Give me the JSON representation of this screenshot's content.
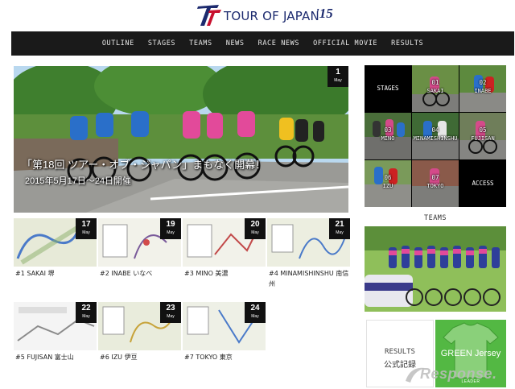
{
  "header": {
    "logo_text": "TOUR OF JAPAN",
    "logo_year": "'15"
  },
  "nav": {
    "items": [
      "OUTLINE",
      "STAGES",
      "TEAMS",
      "NEWS",
      "RACE NEWS",
      "OFFICIAL MOVIE",
      "RESULTS"
    ]
  },
  "hero": {
    "badge_day": "1",
    "badge_month": "May",
    "headline": "「第18回 ツアー・オブ・ジャパン」まもなく開幕！",
    "subline": "2015年5月17日〜24日開催"
  },
  "stages": [
    {
      "day": "17",
      "month": "May",
      "label": "#1 SAKAI 堺"
    },
    {
      "day": "19",
      "month": "May",
      "label": "#2 INABE いなべ"
    },
    {
      "day": "20",
      "month": "May",
      "label": "#3 MINO 美濃"
    },
    {
      "day": "21",
      "month": "May",
      "label": "#4 MINAMISHINSHU 南信州"
    },
    {
      "day": "22",
      "month": "May",
      "label": "#5 FUJISAN 富士山"
    },
    {
      "day": "23",
      "month": "May",
      "label": "#6 IZU 伊豆"
    },
    {
      "day": "24",
      "month": "May",
      "label": "#7 TOKYO 東京"
    }
  ],
  "stage_grid": {
    "title": "STAGES",
    "cells": [
      {
        "num": "01",
        "name": "SAKAI"
      },
      {
        "num": "02",
        "name": "INABE"
      },
      {
        "num": "03",
        "name": "MINO"
      },
      {
        "num": "04",
        "name": "MINAMISHINSHU"
      },
      {
        "num": "05",
        "name": "FUJISAN"
      },
      {
        "num": "06",
        "name": "IZU"
      },
      {
        "num": "07",
        "name": "TOKYO"
      }
    ],
    "access": "ACCESS"
  },
  "teams": {
    "title": "TEAMS"
  },
  "results": {
    "line1": "RESULTS",
    "line2": "公式記録"
  },
  "jersey": {
    "title": "GREEN Jersey",
    "sub": "LEADER"
  },
  "watermark": {
    "text": "Response."
  },
  "colors": {
    "nav_bg": "#1a1a1a",
    "logo_blue": "#1c2a6e",
    "logo_red": "#c8102e",
    "jersey_green": "#53b843"
  }
}
